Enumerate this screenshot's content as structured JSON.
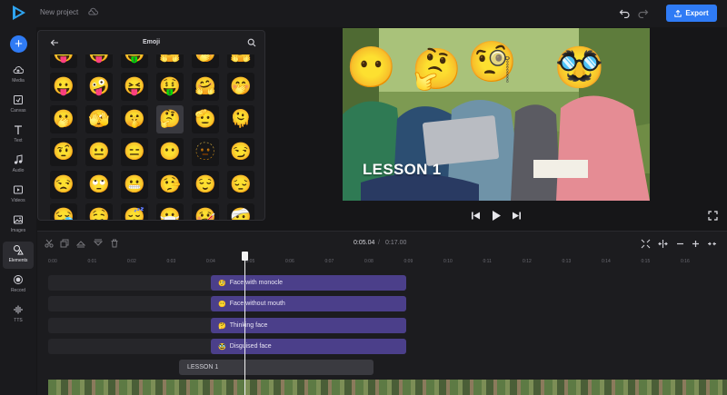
{
  "header": {
    "project_name": "New project",
    "export_label": "Export"
  },
  "sidebar": {
    "items": [
      {
        "label": "Media",
        "icon": "upload-cloud-icon"
      },
      {
        "label": "Canvas",
        "icon": "canvas-icon"
      },
      {
        "label": "Text",
        "icon": "text-icon"
      },
      {
        "label": "Audio",
        "icon": "music-note-icon"
      },
      {
        "label": "Videos",
        "icon": "video-icon"
      },
      {
        "label": "Images",
        "icon": "image-icon"
      },
      {
        "label": "Elements",
        "icon": "shapes-icon",
        "active": true
      },
      {
        "label": "Record",
        "icon": "record-icon"
      },
      {
        "label": "TTS",
        "icon": "waveform-icon"
      }
    ]
  },
  "emoji_panel": {
    "title": "Emoji",
    "emojis": [
      [
        "😝",
        "😜",
        "🤑",
        "🤗",
        "🤭",
        "🤗"
      ],
      [
        "😛",
        "🤪",
        "😝",
        "🤑",
        "🤗",
        "🤭"
      ],
      [
        "🫢",
        "🫣",
        "🤫",
        "🤔",
        "🫡",
        "🫠"
      ],
      [
        "🤨",
        "😐",
        "😑",
        "😶",
        "🫥",
        "😏"
      ],
      [
        "😒",
        "🙄",
        "😬",
        "🤥",
        "😌",
        "😔"
      ],
      [
        "😪",
        "🤤",
        "😴",
        "😷",
        "🤒",
        "🤕"
      ]
    ],
    "selected": "🤔"
  },
  "preview": {
    "caption": "LESSON 1",
    "overlays": [
      "😶",
      "🤔",
      "🧐",
      "🥸"
    ]
  },
  "timeline": {
    "current_time": "0:05.04",
    "separator": "/",
    "total_time": "0:17.00",
    "ticks": [
      "0:00",
      "0:01",
      "0:02",
      "0:03",
      "0:04",
      "0:05",
      "0:06",
      "0:07",
      "0:08",
      "0:09",
      "0:10",
      "0:11",
      "0:12",
      "0:13",
      "0:14",
      "0:15",
      "0:16"
    ],
    "tracks": [
      {
        "emoji": "🧐",
        "label": "Face with monocle"
      },
      {
        "emoji": "😶",
        "label": "Face without mouth"
      },
      {
        "emoji": "🤔",
        "label": "Thinking face"
      },
      {
        "emoji": "🥸",
        "label": "Disguised face"
      }
    ],
    "text_clip": "LESSON 1"
  },
  "colors": {
    "accent": "#2f7bf5",
    "emoji_clip": "#4b3f8a"
  }
}
